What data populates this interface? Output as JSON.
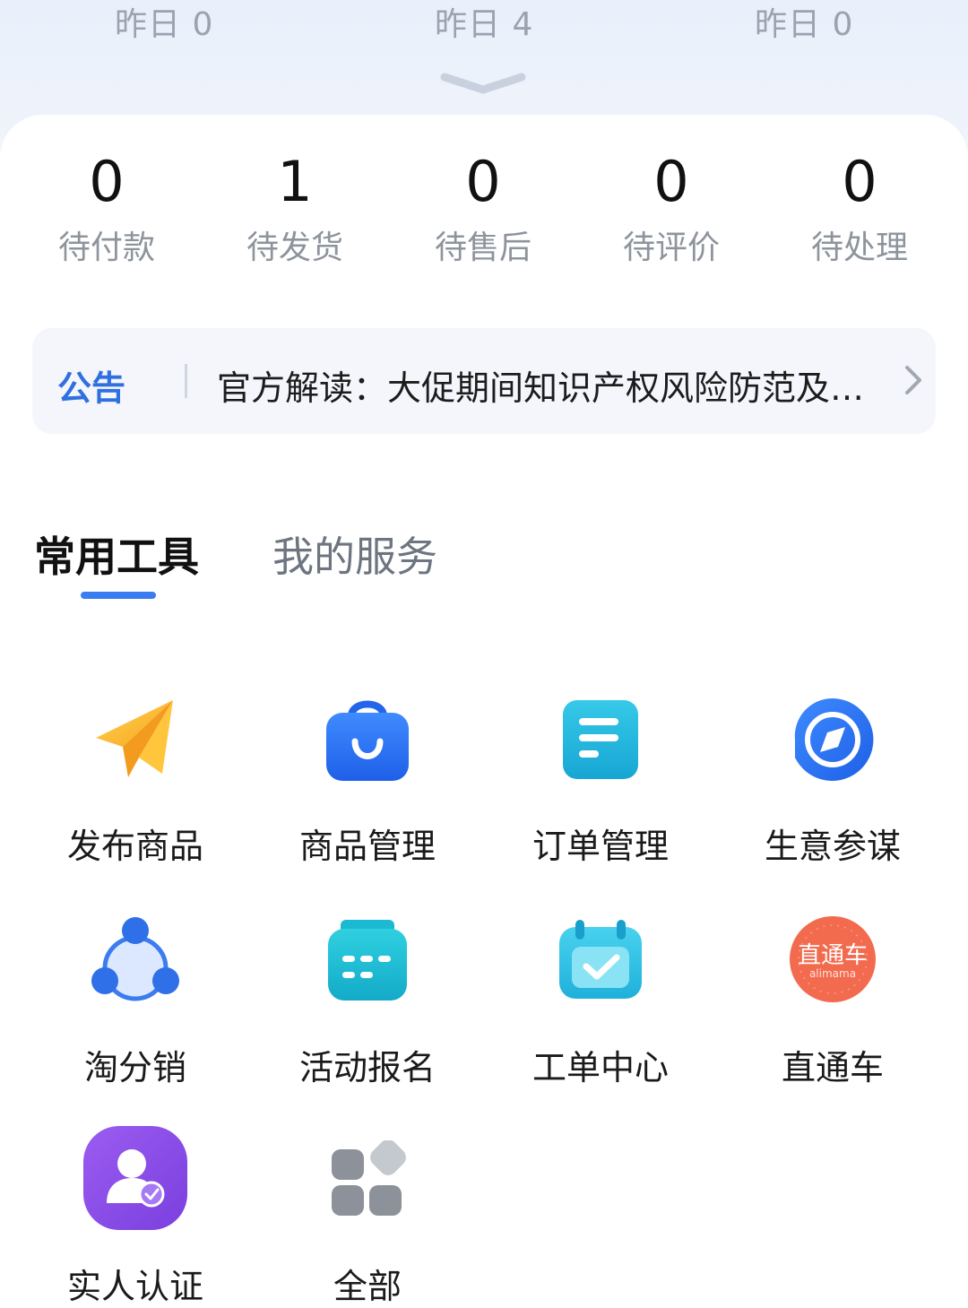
{
  "yesterday": [
    "昨日 0",
    "昨日 4",
    "昨日 0"
  ],
  "order_stats": [
    {
      "value": "0",
      "label": "待付款"
    },
    {
      "value": "1",
      "label": "待发货"
    },
    {
      "value": "0",
      "label": "待售后"
    },
    {
      "value": "0",
      "label": "待评价"
    },
    {
      "value": "0",
      "label": "待处理"
    }
  ],
  "notice": {
    "tag": "公告",
    "text": "官方解读：大促期间知识产权风险防范及…"
  },
  "tabs": {
    "active": "常用工具",
    "inactive": "我的服务"
  },
  "tools": [
    {
      "label": "发布商品",
      "icon": "paper-plane-icon"
    },
    {
      "label": "商品管理",
      "icon": "shopping-bag-icon"
    },
    {
      "label": "订单管理",
      "icon": "document-list-icon"
    },
    {
      "label": "生意参谋",
      "icon": "compass-icon"
    },
    {
      "label": "淘分销",
      "icon": "share-network-icon"
    },
    {
      "label": "活动报名",
      "icon": "calendar-grid-icon"
    },
    {
      "label": "工单中心",
      "icon": "calendar-check-icon"
    },
    {
      "label": "直通车",
      "icon": "ztc-logo-icon"
    },
    {
      "label": "实人认证",
      "icon": "user-verified-icon"
    },
    {
      "label": "全部",
      "icon": "all-apps-icon"
    }
  ],
  "ztc_logo": {
    "main": "直通车",
    "sub": "alimama"
  },
  "colors": {
    "accent": "#3b7cf0",
    "notice_tag": "#2f6fe0",
    "ztc": "#f36b4f",
    "verify": "#8b4be0"
  }
}
